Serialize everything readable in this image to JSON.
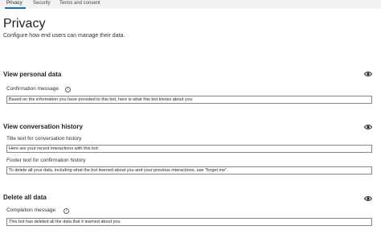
{
  "tabs": [
    "Privacy",
    "Security",
    "Terms and consent"
  ],
  "page": {
    "title": "Privacy",
    "subtitle": "Configure how end users can manage their data."
  },
  "sections": {
    "view_personal": {
      "title": "View personal data",
      "confirmation_label": "Confirmation message",
      "confirmation_value": "Based on the information you have provided to this bot, here is what this bot knows about you:"
    },
    "view_history": {
      "title": "View conversation history",
      "title_text_label": "Title text for conversation history",
      "title_text_value": "Here are your recent interactions with this bot:",
      "footer_text_label": "Footer text for confirmation history",
      "footer_text_value": "To delete all your data, including what the bot learned about you and your previous interactions, use \"forget me\"."
    },
    "delete_all": {
      "title": "Delete all data",
      "completion_label": "Completion message",
      "completion_value": "This bot has deleted all the data that it learned about you"
    }
  },
  "icons": {
    "info": "info-icon",
    "eye": "eye-icon"
  },
  "colors": {
    "accent": "#106ebe",
    "tabbar": "#f3f2f1"
  }
}
